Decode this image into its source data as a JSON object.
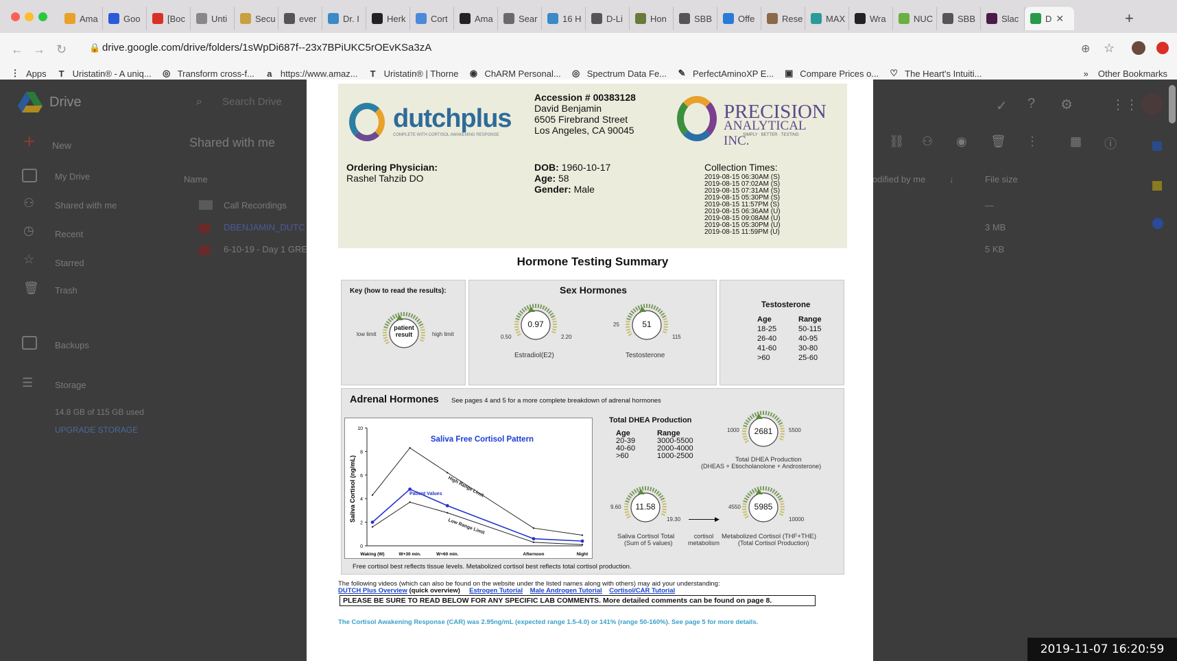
{
  "browser": {
    "tabs": [
      "Ama",
      "Goo",
      "[Boc",
      "Unti",
      "Secu",
      "ever",
      "Dr. I",
      "Herk",
      "Cort",
      "Ama",
      "Sear",
      "16 H",
      "D-Li",
      "Hon",
      "SBB",
      "Offe",
      "Rese",
      "MAX",
      "Wra",
      "NUC",
      "SBB",
      "Slac",
      "D"
    ],
    "url": "drive.google.com/drive/folders/1sWpDi687f--23x7BPiUKC5rOEvKSa3zA",
    "bookmarks": [
      "Apps",
      "Uristatin® - A uniq...",
      "Transform cross-f...",
      "https://www.amaz...",
      "Uristatin® | Thorne",
      "ChARM Personal...",
      "Spectrum Data Fe...",
      "PerfectAminoXP E...",
      "Compare Prices o...",
      "The Heart's Intuiti..."
    ],
    "more_bookmarks": "»",
    "other_bookmarks": "Other Bookmarks"
  },
  "drive": {
    "title": "Drive",
    "search_placeholder": "Search Drive",
    "breadcrumb": "Shared with me",
    "new_label": "New",
    "nav": [
      "My Drive",
      "Shared with me",
      "Recent",
      "Starred",
      "Trash",
      "Backups",
      "Storage"
    ],
    "storage_used": "14.8 GB of 115 GB used",
    "upgrade": "UPGRADE STORAGE",
    "col_name": "Name",
    "col_modified": "odified by me",
    "col_size": "File size",
    "files": [
      "Call Recordings",
      "DBENJAMIN_DUTC",
      "6-10-19 - Day 1 GRE"
    ],
    "sizes": [
      "—",
      "3 MB",
      "5 KB"
    ]
  },
  "report": {
    "dutch_name": "dutchplus",
    "dutch_sub": "COMPLETE WITH CORTISOL AWAKENING RESPONSE",
    "accession": "Accession # 00383128",
    "patient_name": "David Benjamin",
    "address1": "6505 Firebrand Street",
    "address2": "Los Angeles, CA 90045",
    "lab_name1": "PRECISION",
    "lab_name2": "ANALYTICAL INC.",
    "lab_sub": "SIMPLY · BETTER · TESTING",
    "physician_label": "Ordering Physician:",
    "physician": "Rashel Tahzib DO",
    "dob_label": "DOB:",
    "dob": "1960-10-17",
    "age_label": "Age:",
    "age": "58",
    "gender_label": "Gender:",
    "gender": "Male",
    "collection_label": "Collection Times:",
    "collection_times": [
      "2019-08-15 06:30AM (S)",
      "2019-08-15 07:02AM (S)",
      "2019-08-15 07:31AM (S)",
      "2019-08-15 05:30PM (S)",
      "2019-08-15 11:57PM (S)",
      "2019-08-15 06:36AM (U)",
      "2019-08-15 09:08AM (U)",
      "2019-08-15 05:30PM (U)",
      "2019-08-15 11:59PM (U)"
    ],
    "summary_title": "Hormone Testing Summary",
    "key_title": "Key (how to read the results):",
    "key_low": "low limit",
    "key_high": "high limit",
    "key_center": "patient result",
    "sex_title": "Sex Hormones",
    "estradiol": {
      "value": "0.97",
      "low": "0.50",
      "high": "2.20",
      "label": "Estradiol(E2)"
    },
    "testosterone": {
      "value": "51",
      "low": "25",
      "high": "115",
      "label": "Testosterone"
    },
    "testo_title": "Testosterone",
    "testo_head": [
      "Age",
      "Range"
    ],
    "testo_rows": [
      [
        "18-25",
        "50-115"
      ],
      [
        "26-40",
        "40-95"
      ],
      [
        "41-60",
        "30-80"
      ],
      [
        ">60",
        "25-60"
      ]
    ],
    "adrenal_title": "Adrenal Hormones",
    "adrenal_note": "See pages 4 and 5 for a more complete breakdown of adrenal hormones",
    "dhea_title": "Total DHEA Production",
    "dhea_head": [
      "Age",
      "Range"
    ],
    "dhea_rows": [
      [
        "20-39",
        "3000-5500"
      ],
      [
        "40-60",
        "2000-4000"
      ],
      [
        ">60",
        "1000-2500"
      ]
    ],
    "dhea_gauge": {
      "value": "2681",
      "low": "1000",
      "high": "5500",
      "label1": "Total DHEA Production",
      "label2": "(DHEAS + Etiocholanolone + Androsterone)"
    },
    "saliva_gauge": {
      "value": "11.58",
      "low": "9.60",
      "high": "19.30",
      "label1": "Saliva Cortisol Total",
      "label2": "(Sum of 5 values)"
    },
    "metab_arrow": "cortisol metabolism",
    "metab_gauge": {
      "value": "5985",
      "low": "4550",
      "high": "10000",
      "label1": "Metabolized Cortisol (THF+THE)",
      "label2": "(Total Cortisol Production)"
    },
    "free_note": "Free cortisol best reflects tissue levels. Metabolized cortisol best reflects total cortisol production.",
    "videos_note": "The following videos (which can also be found on the website under the listed names along with others) may aid your understanding:",
    "video_links": [
      "DUTCH Plus Overview",
      "Estrogen Tutorial",
      "Male Androgen Tutorial",
      "Cortisol/CAR Tutorial"
    ],
    "video_quick": "(quick overview)",
    "comments_box": "PLEASE BE SURE TO READ BELOW FOR ANY SPECIFIC LAB COMMENTS. More detailed comments can be found on page 8.",
    "car_note": "The Cortisol Awakening Response (CAR) was 2.95ng/mL (expected range 1.5-4.0) or 141% (range 50-160%). See page 5 for more details."
  },
  "chart_data": {
    "type": "line",
    "title": "Saliva Free Cortisol Pattern",
    "xlabel": "",
    "ylabel": "Saliva Cortisol (ng/mL)",
    "categories": [
      "Waking (W)",
      "W+30 min.",
      "W+60 min.",
      "Afternoon",
      "Night"
    ],
    "x_positions": [
      0,
      1,
      2,
      4.3,
      5.6
    ],
    "ylim": [
      0,
      10
    ],
    "yticks": [
      0,
      2,
      4,
      6,
      8,
      10
    ],
    "series": [
      {
        "name": "High Range Limit",
        "values": [
          4.3,
          8.3,
          6.2,
          1.5,
          0.9
        ],
        "color": "#222222"
      },
      {
        "name": "Patient Values",
        "values": [
          2.0,
          4.8,
          3.4,
          0.6,
          0.4
        ],
        "color": "#2233cc"
      },
      {
        "name": "Low Range Limit",
        "values": [
          1.6,
          3.7,
          2.8,
          0.3,
          0.1
        ],
        "color": "#222222"
      }
    ]
  },
  "timestamp": "2019-11-07  16:20:59"
}
